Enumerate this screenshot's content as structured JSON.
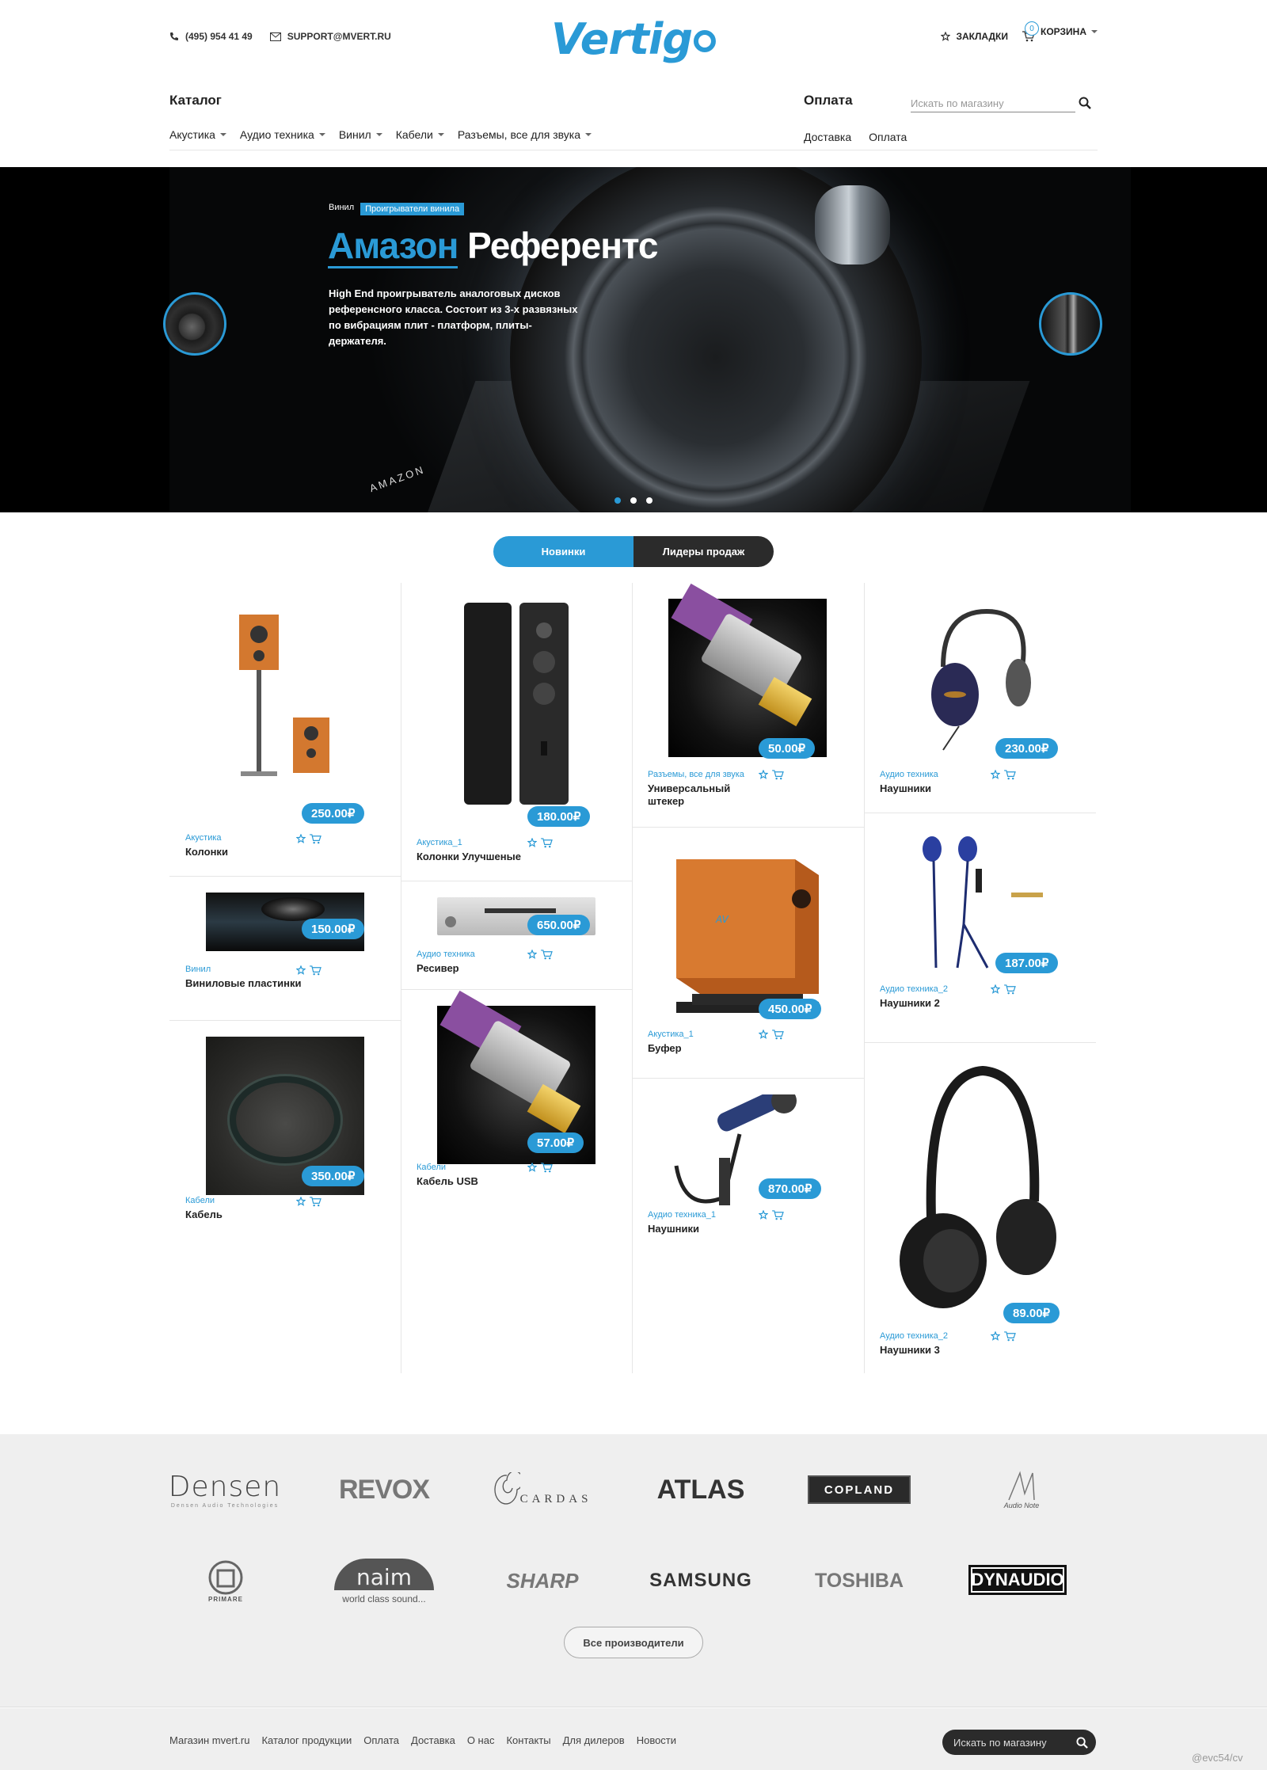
{
  "header": {
    "phone": "(495) 954 41 49",
    "email": "SUPPORT@MVERT.RU",
    "logo_text": "Vertig",
    "bookmarks": "ЗАКЛАДКИ",
    "cart_label": "КОРЗИНА",
    "cart_count": "0"
  },
  "nav": {
    "catalog_title": "Каталог",
    "menu": [
      "Акустика",
      "Аудио техника",
      "Винил",
      "Кабели",
      "Разъемы, все для звука"
    ],
    "payment_title": "Оплата",
    "payment_links": [
      "Доставка",
      "Оплата"
    ],
    "search_placeholder": "Искать по магазину"
  },
  "hero": {
    "crumb_1": "Винил",
    "crumb_2": "Проигрыватели винила",
    "title_highlight": "Амазон",
    "title_rest": "Референтс",
    "description": "High End проигрыватель аналоговых дисков референсного класса. Состоит из 3-х развязных по вибрациям плит - платформ, плиты-держателя.",
    "brand_mark": "AMAZON",
    "slides": 3,
    "active_slide": 1
  },
  "tabs": [
    "Новинки",
    "Лидеры продаж"
  ],
  "products": [
    {
      "category": "Акустика",
      "name": "Колонки",
      "price": "250.00₽"
    },
    {
      "category": "Винил",
      "name": "Виниловые пластинки",
      "price": "150.00₽"
    },
    {
      "category": "Кабели",
      "name": "Кабель",
      "price": "350.00₽"
    },
    {
      "category": "Акустика_1",
      "name": "Колонки Улучшеные",
      "price": "180.00₽"
    },
    {
      "category": "Аудио техника",
      "name": "Ресивер",
      "price": "650.00₽"
    },
    {
      "category": "Кабели",
      "name": "Кабель USB",
      "price": "57.00₽"
    },
    {
      "category": "Разъемы, все для звука",
      "name": "Универсальный штекер",
      "price": "50.00₽"
    },
    {
      "category": "Акустика_1",
      "name": "Буфер",
      "price": "450.00₽"
    },
    {
      "category": "Аудио техника_1",
      "name": "Наушники",
      "price": "870.00₽"
    },
    {
      "category": "Аудио техника",
      "name": "Наушники",
      "price": "230.00₽"
    },
    {
      "category": "Аудио техника_2",
      "name": "Наушники 2",
      "price": "187.00₽"
    },
    {
      "category": "Аудио техника_2",
      "name": "Наушники 3",
      "price": "89.00₽"
    }
  ],
  "brands": [
    "Densen",
    "REVOX",
    "CARDAS",
    "ATLAS",
    "COPLAND",
    "Audio Note",
    "PRIMARE",
    "naim",
    "SHARP",
    "SAMSUNG",
    "TOSHIBA",
    "DYNAUDIO"
  ],
  "brand_taglines": {
    "densen": "Densen Audio Technologies",
    "naim": "world class sound..."
  },
  "all_brands_button": "Все производители",
  "footer": {
    "links": [
      "Магазин mvert.ru",
      "Каталог продукции",
      "Оплата",
      "Доставка",
      "О нас",
      "Контакты",
      "Для дилеров",
      "Новости"
    ],
    "search_placeholder": "Искать по магазину"
  },
  "watermark": "@evc54/cv",
  "colors": {
    "accent": "#2a9ad6",
    "dark": "#2b2b2b"
  }
}
